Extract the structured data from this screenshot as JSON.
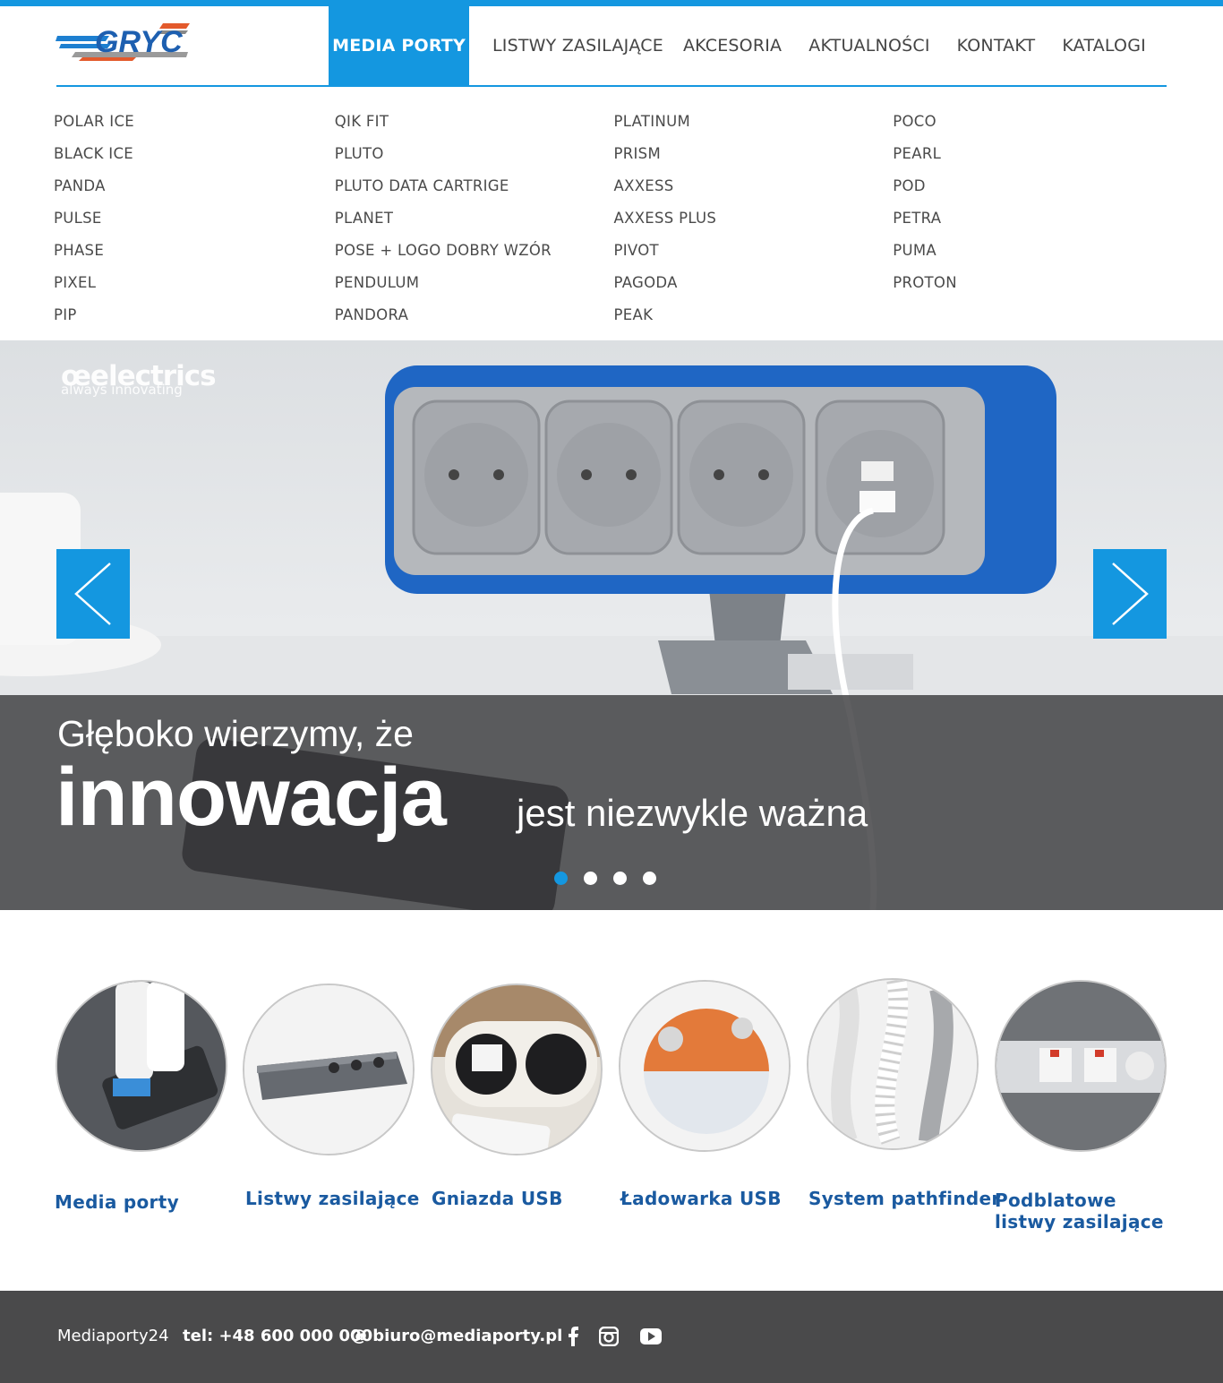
{
  "brand": {
    "logo_text": "GRYC"
  },
  "nav": {
    "items": [
      {
        "label": "MEDIA PORTY",
        "active": true
      },
      {
        "label": "LISTWY ZASILAJĄCE"
      },
      {
        "label": "AKCESORIA"
      },
      {
        "label": "AKTUALNOŚCI"
      },
      {
        "label": "KONTAKT"
      },
      {
        "label": "KATALOGI"
      }
    ]
  },
  "megamenu": {
    "columns": [
      [
        "POLAR ICE",
        "BLACK ICE",
        "PANDA",
        "PULSE",
        "PHASE",
        "PIXEL",
        "PIP"
      ],
      [
        "QIK FIT",
        "PLUTO",
        "PLUTO DATA CARTRIGE",
        "PLANET",
        "POSE + LOGO DOBRY WZÓR",
        "PENDULUM",
        "PANDORA"
      ],
      [
        "PLATINUM",
        "PRISM",
        "AXXESS",
        "AXXESS PLUS",
        "PIVOT",
        "PAGODA",
        "PEAK"
      ],
      [
        "POCO",
        "PEARL",
        "POD",
        "PETRA",
        "PUMA",
        "PROTON"
      ]
    ]
  },
  "hero": {
    "brand_logo": "œelectrics",
    "brand_tagline": "always innovating",
    "caption_line1": "Głęboko wierzymy, że",
    "caption_big": "innowacja",
    "caption_line2": "jest niezwykle ważna",
    "slides_total": 4,
    "active_slide": 1
  },
  "categories": [
    {
      "label": "Media porty"
    },
    {
      "label": "Listwy zasilające"
    },
    {
      "label": "Gniazda USB"
    },
    {
      "label": "Ładowarka USB"
    },
    {
      "label": "System pathfinder"
    },
    {
      "label_line1": "Podblatowe",
      "label_line2": "listwy zasilające"
    }
  ],
  "footer": {
    "company": "Mediaporty24",
    "phone": "tel: +48 600 000 000",
    "email": "@ biuro@mediaporty.pl",
    "social": [
      "facebook-icon",
      "instagram-icon",
      "youtube-icon"
    ]
  },
  "colors": {
    "accent": "#1497e0",
    "category_text": "#1a5aa0",
    "footer_bg": "#4a4a4b"
  }
}
